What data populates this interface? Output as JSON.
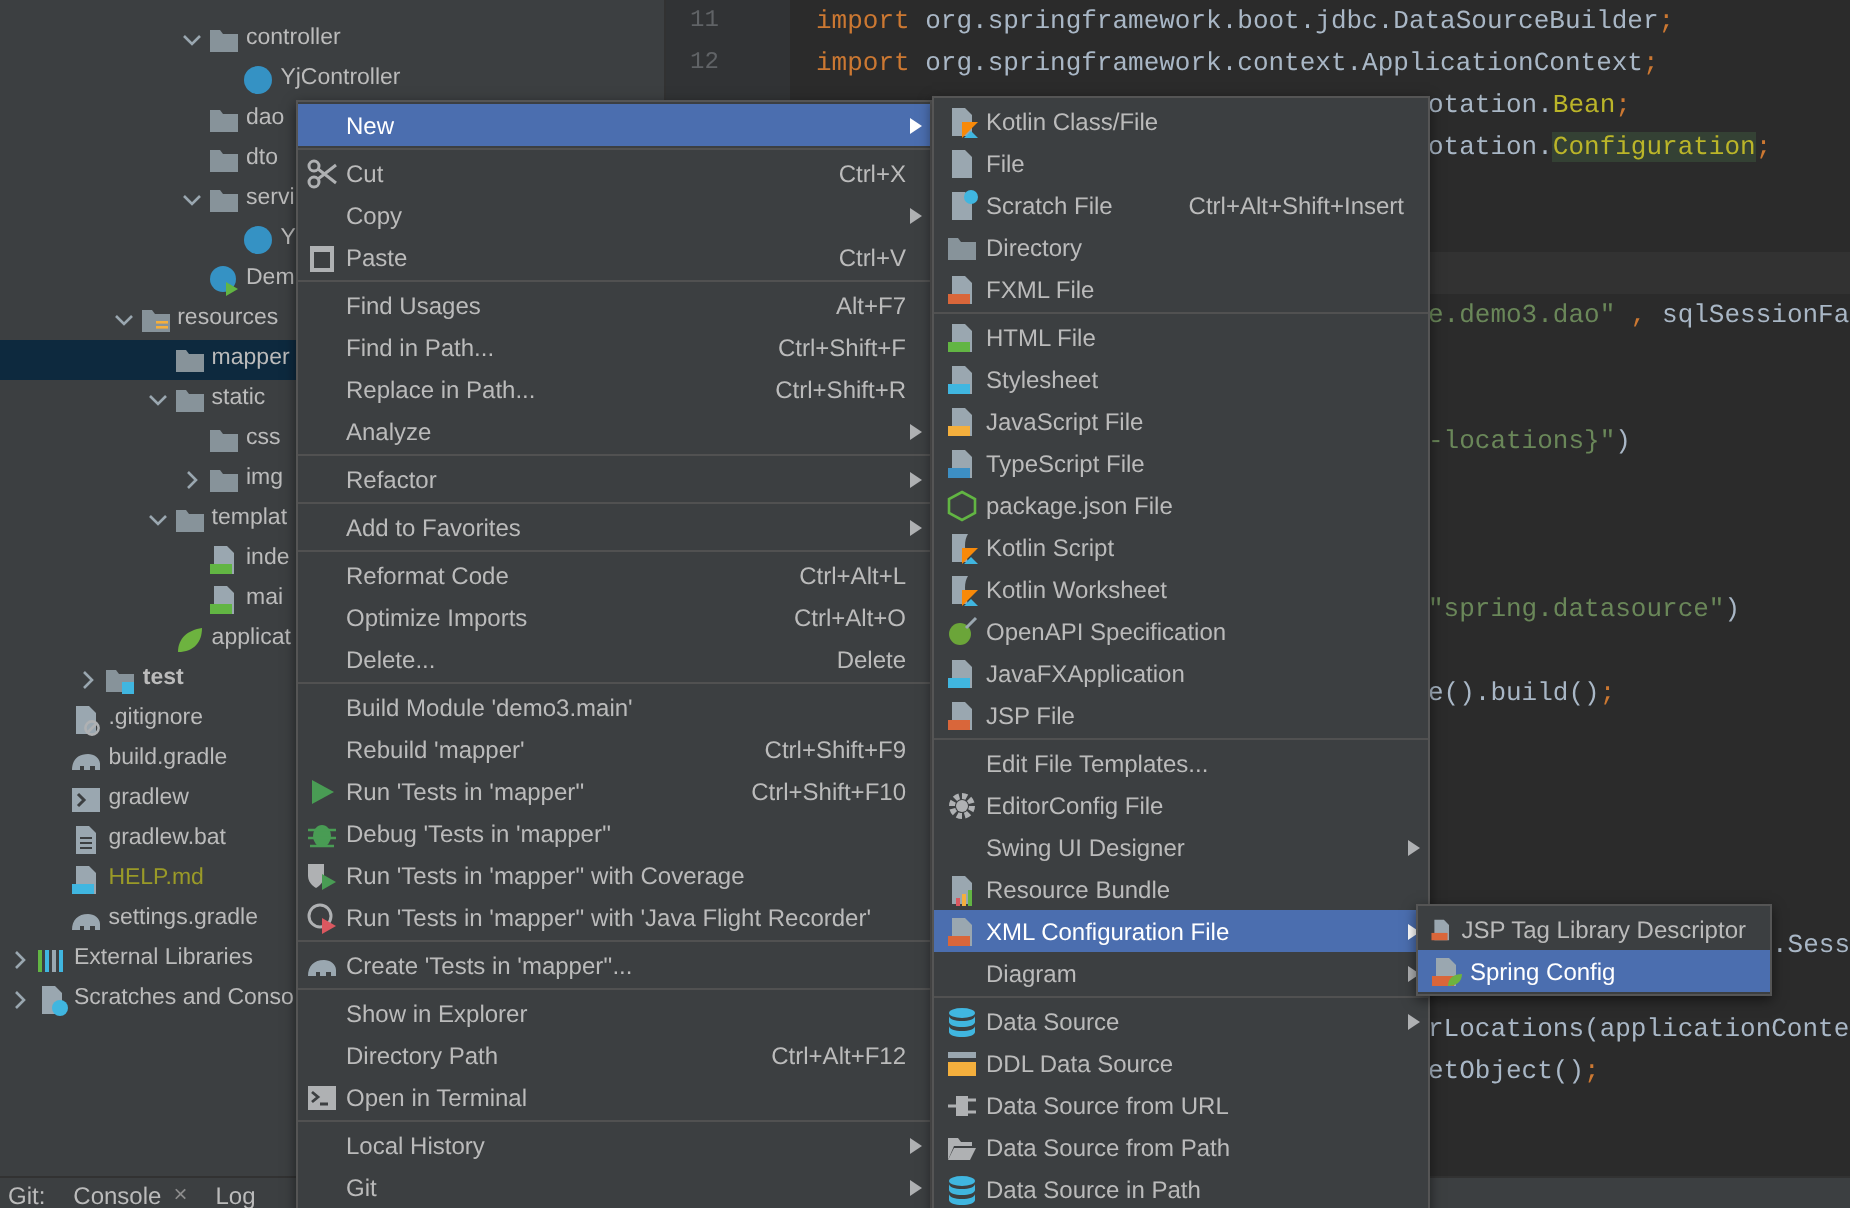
{
  "tree": [
    {
      "children": [
        {
          "children": [
            {
              "children": [
                {
                  "children": [
                    {
                      "children": [
                        {
                          "label": "controller",
                          "kind": "folder",
                          "expanded": true,
                          "selected": false,
                          "children": [
                            {
                              "label": "YjController",
                              "kind": "class",
                              "selected": false
                            }
                          ]
                        },
                        {
                          "label": "dao",
                          "kind": "folder",
                          "selected": false
                        },
                        {
                          "label": "dto",
                          "kind": "folder",
                          "selected": false
                        },
                        {
                          "label": "servi",
                          "kind": "folder",
                          "expanded": true,
                          "selected": false,
                          "children": [
                            {
                              "label": "Y",
                              "kind": "class",
                              "selected": false
                            }
                          ]
                        },
                        {
                          "label": "Dem",
                          "kind": "spring-class",
                          "selected": false
                        }
                      ]
                    }
                  ]
                },
                {
                  "label": "resources",
                  "kind": "resources-folder",
                  "expanded": true,
                  "selected": false,
                  "children": [
                    {
                      "label": "mapper",
                      "kind": "folder",
                      "selected": true
                    },
                    {
                      "label": "static",
                      "kind": "folder",
                      "expanded": true,
                      "selected": false,
                      "children": [
                        {
                          "label": "css",
                          "kind": "folder",
                          "selected": false
                        },
                        {
                          "label": "img",
                          "kind": "folder",
                          "expanded": false,
                          "selected": false
                        }
                      ]
                    },
                    {
                      "label": "templat",
                      "kind": "folder",
                      "expanded": true,
                      "selected": false,
                      "children": [
                        {
                          "label": "inde",
                          "kind": "html",
                          "selected": false
                        },
                        {
                          "label": "mai",
                          "kind": "html",
                          "selected": false
                        }
                      ]
                    },
                    {
                      "label": "applicat",
                      "kind": "spring-boot",
                      "selected": false
                    }
                  ]
                }
              ]
            },
            {
              "label": "test",
              "kind": "test-folder",
              "expanded": false,
              "selected": false
            }
          ]
        },
        {
          "label": ".gitignore",
          "kind": "gitignore",
          "selected": false
        },
        {
          "label": "build.gradle",
          "kind": "gradle",
          "selected": false
        },
        {
          "label": "gradlew",
          "kind": "script",
          "selected": false
        },
        {
          "label": "gradlew.bat",
          "kind": "text",
          "selected": false
        },
        {
          "label": "HELP.md",
          "kind": "markdown",
          "color": "#9a9a28",
          "selected": false
        },
        {
          "label": "settings.gradle",
          "kind": "gradle",
          "selected": false
        }
      ]
    },
    {
      "label": "External Libraries",
      "kind": "libraries",
      "expanded": false,
      "selected": false
    },
    {
      "label": "Scratches and Conso",
      "kind": "scratches",
      "expanded": false,
      "selected": false
    }
  ],
  "editor": {
    "lines": [
      {
        "kind": "line",
        "number": "11",
        "tokens": [
          {
            "kind": "keyword",
            "text": "import"
          },
          {
            "kind": "plain",
            "text": " org.springframework.boot.jdbc.DataSourceBuilder"
          },
          {
            "kind": "keyword",
            "text": ";"
          }
        ]
      },
      {
        "kind": "line",
        "number": "12",
        "tokens": [
          {
            "kind": "keyword",
            "text": "import"
          },
          {
            "kind": "plain",
            "text": " org.springframework.context.ApplicationContext"
          },
          {
            "kind": "keyword",
            "text": ";"
          }
        ]
      },
      {
        "kind": "fragment",
        "tokens": [
          {
            "kind": "plain",
            "text": "otation."
          },
          {
            "kind": "annotation",
            "text": "Bean"
          },
          {
            "kind": "keyword",
            "text": ";"
          }
        ]
      },
      {
        "kind": "fragment",
        "tokens": [
          {
            "kind": "plain",
            "text": "otation."
          },
          {
            "kind": "annotation",
            "text": "Configuration",
            "highlighted": true
          },
          {
            "kind": "keyword",
            "text": ";"
          }
        ]
      },
      {
        "kind": "blank"
      },
      {
        "kind": "blank"
      },
      {
        "kind": "blank",
        "current": true
      },
      {
        "kind": "fragment",
        "tokens": [
          {
            "kind": "string",
            "text": "e.demo3.dao\""
          },
          {
            "kind": "keyword",
            "text": " , "
          },
          {
            "kind": "plain",
            "text": "sqlSessionFa"
          }
        ]
      },
      {
        "kind": "blank"
      },
      {
        "kind": "blank"
      },
      {
        "kind": "fragment",
        "tokens": [
          {
            "kind": "string",
            "text": "-locations}\""
          },
          {
            "kind": "plain",
            "text": ")"
          }
        ]
      },
      {
        "kind": "blank"
      },
      {
        "kind": "blank"
      },
      {
        "kind": "blank"
      },
      {
        "kind": "fragment",
        "tokens": [
          {
            "kind": "string",
            "text": "\"spring.datasource\""
          },
          {
            "kind": "plain",
            "text": ")"
          }
        ]
      },
      {
        "kind": "blank"
      },
      {
        "kind": "fragment",
        "tokens": [
          {
            "kind": "plain",
            "text": "e().build()"
          },
          {
            "kind": "keyword",
            "text": ";"
          }
        ]
      },
      {
        "kind": "blank"
      },
      {
        "kind": "blank"
      },
      {
        "kind": "blank"
      },
      {
        "kind": "blank"
      },
      {
        "kind": "blank"
      },
      {
        "kind": "edge",
        "tokens": [
          {
            "kind": "plain",
            "text": ".Sess"
          }
        ]
      },
      {
        "kind": "blank"
      },
      {
        "kind": "fragment",
        "tokens": [
          {
            "kind": "plain",
            "text": "rLocations(applicationConte"
          }
        ]
      },
      {
        "kind": "fragment",
        "tokens": [
          {
            "kind": "plain",
            "text": "etObject()"
          },
          {
            "kind": "keyword",
            "text": ";"
          }
        ]
      }
    ]
  },
  "bottom_bar": {
    "label": "Git:",
    "tabs": [
      {
        "label": "Console",
        "close": "×",
        "selected": false
      },
      {
        "label": "Log",
        "selected": false
      }
    ]
  },
  "context_menu": {
    "groups": [
      {
        "items": [
          {
            "label": "New",
            "submenu": true,
            "selected": true
          }
        ]
      },
      {
        "items": [
          {
            "label": "Cut",
            "kind": "cut",
            "shortcut": "Ctrl+X",
            "submenu": false,
            "selected": false
          },
          {
            "label": "Copy",
            "submenu": true,
            "selected": false
          },
          {
            "label": "Paste",
            "kind": "paste",
            "shortcut": "Ctrl+V",
            "submenu": false,
            "selected": false
          }
        ]
      },
      {
        "items": [
          {
            "label": "Find Usages",
            "shortcut": "Alt+F7",
            "submenu": false,
            "selected": false
          },
          {
            "label": "Find in Path...",
            "shortcut": "Ctrl+Shift+F",
            "submenu": false,
            "selected": false
          },
          {
            "label": "Replace in Path...",
            "shortcut": "Ctrl+Shift+R",
            "submenu": false,
            "selected": false
          },
          {
            "label": "Analyze",
            "submenu": true,
            "selected": false
          }
        ]
      },
      {
        "items": [
          {
            "label": "Refactor",
            "submenu": true,
            "selected": false
          }
        ]
      },
      {
        "items": [
          {
            "label": "Add to Favorites",
            "submenu": true,
            "selected": false
          }
        ]
      },
      {
        "items": [
          {
            "label": "Reformat Code",
            "shortcut": "Ctrl+Alt+L",
            "submenu": false,
            "selected": false
          },
          {
            "label": "Optimize Imports",
            "shortcut": "Ctrl+Alt+O",
            "submenu": false,
            "selected": false
          },
          {
            "label": "Delete...",
            "shortcut": "Delete",
            "submenu": false,
            "selected": false
          }
        ]
      },
      {
        "items": [
          {
            "label": "Build Module 'demo3.main'",
            "submenu": false,
            "selected": false
          },
          {
            "label": "Rebuild 'mapper'",
            "shortcut": "Ctrl+Shift+F9",
            "submenu": false,
            "selected": false
          },
          {
            "label": "Run 'Tests in 'mapper''",
            "kind": "run",
            "shortcut": "Ctrl+Shift+F10",
            "submenu": false,
            "selected": false
          },
          {
            "label": "Debug 'Tests in 'mapper''",
            "kind": "debug",
            "submenu": false,
            "selected": false
          },
          {
            "label": "Run 'Tests in 'mapper'' with Coverage",
            "kind": "coverage",
            "submenu": false,
            "selected": false
          },
          {
            "label": "Run 'Tests in 'mapper'' with 'Java Flight Recorder'",
            "kind": "jfr",
            "submenu": false,
            "selected": false
          }
        ]
      },
      {
        "items": [
          {
            "label": "Create 'Tests in 'mapper''...",
            "kind": "gradle",
            "submenu": false,
            "selected": false
          }
        ]
      },
      {
        "items": [
          {
            "label": "Show in Explorer",
            "submenu": false,
            "selected": false
          },
          {
            "label": "Directory Path",
            "shortcut": "Ctrl+Alt+F12",
            "submenu": false,
            "selected": false
          },
          {
            "label": "Open in Terminal",
            "kind": "terminal",
            "submenu": false,
            "selected": false
          }
        ]
      },
      {
        "items": [
          {
            "label": "Local History",
            "submenu": true,
            "selected": false
          },
          {
            "label": "Git",
            "submenu": true,
            "selected": false
          }
        ]
      }
    ]
  },
  "new_submenu": {
    "groups": [
      {
        "items": [
          {
            "label": "Kotlin Class/File",
            "kind": "kotlin-file",
            "submenu": false,
            "selected": false
          },
          {
            "label": "File",
            "kind": "file",
            "submenu": false,
            "selected": false
          },
          {
            "label": "Scratch File",
            "kind": "scratch",
            "shortcut": "Ctrl+Alt+Shift+Insert",
            "submenu": false,
            "selected": false
          },
          {
            "label": "Directory",
            "kind": "folder",
            "submenu": false,
            "selected": false
          },
          {
            "label": "FXML File",
            "kind": "xml",
            "submenu": false,
            "selected": false
          }
        ]
      },
      {
        "items": [
          {
            "label": "HTML File",
            "kind": "html",
            "submenu": false,
            "selected": false
          },
          {
            "label": "Stylesheet",
            "kind": "css",
            "submenu": false,
            "selected": false
          },
          {
            "label": "JavaScript File",
            "kind": "js",
            "submenu": false,
            "selected": false
          },
          {
            "label": "TypeScript File",
            "kind": "ts",
            "submenu": false,
            "selected": false
          },
          {
            "label": "package.json File",
            "kind": "npm",
            "submenu": false,
            "selected": false
          },
          {
            "label": "Kotlin Script",
            "kind": "kotlin-script",
            "submenu": false,
            "selected": false
          },
          {
            "label": "Kotlin Worksheet",
            "kind": "kotlin-script",
            "submenu": false,
            "selected": false
          },
          {
            "label": "OpenAPI Specification",
            "kind": "openapi",
            "submenu": false,
            "selected": false
          },
          {
            "label": "JavaFXApplication",
            "kind": "javafx",
            "submenu": false,
            "selected": false
          },
          {
            "label": "JSP File",
            "kind": "jsp",
            "submenu": false,
            "selected": false
          }
        ]
      },
      {
        "items": [
          {
            "label": "Edit File Templates...",
            "submenu": false,
            "selected": false
          },
          {
            "label": "EditorConfig File",
            "kind": "gear",
            "submenu": false,
            "selected": false
          },
          {
            "label": "Swing UI Designer",
            "submenu": true,
            "selected": false
          },
          {
            "label": "Resource Bundle",
            "kind": "resource-bundle",
            "submenu": false,
            "selected": false
          },
          {
            "label": "XML Configuration File",
            "kind": "xml",
            "submenu": true,
            "selected": true
          },
          {
            "label": "Diagram",
            "submenu": true,
            "selected": false
          }
        ]
      },
      {
        "items": [
          {
            "label": "Data Source",
            "kind": "datasource",
            "submenu": true,
            "selected": false
          },
          {
            "label": "DDL Data Source",
            "kind": "ddl",
            "submenu": false,
            "selected": false
          },
          {
            "label": "Data Source from URL",
            "kind": "url",
            "submenu": false,
            "selected": false
          },
          {
            "label": "Data Source from Path",
            "kind": "path",
            "submenu": false,
            "selected": false
          },
          {
            "label": "Data Source in Path",
            "kind": "datasource",
            "submenu": false,
            "selected": false
          }
        ]
      }
    ]
  },
  "xml_submenu": {
    "groups": [
      {
        "items": [
          {
            "label": "JSP Tag Library Descriptor",
            "kind": "xml",
            "submenu": false,
            "selected": false
          },
          {
            "label": "Spring Config",
            "kind": "spring-config",
            "submenu": false,
            "selected": true
          }
        ]
      }
    ]
  }
}
